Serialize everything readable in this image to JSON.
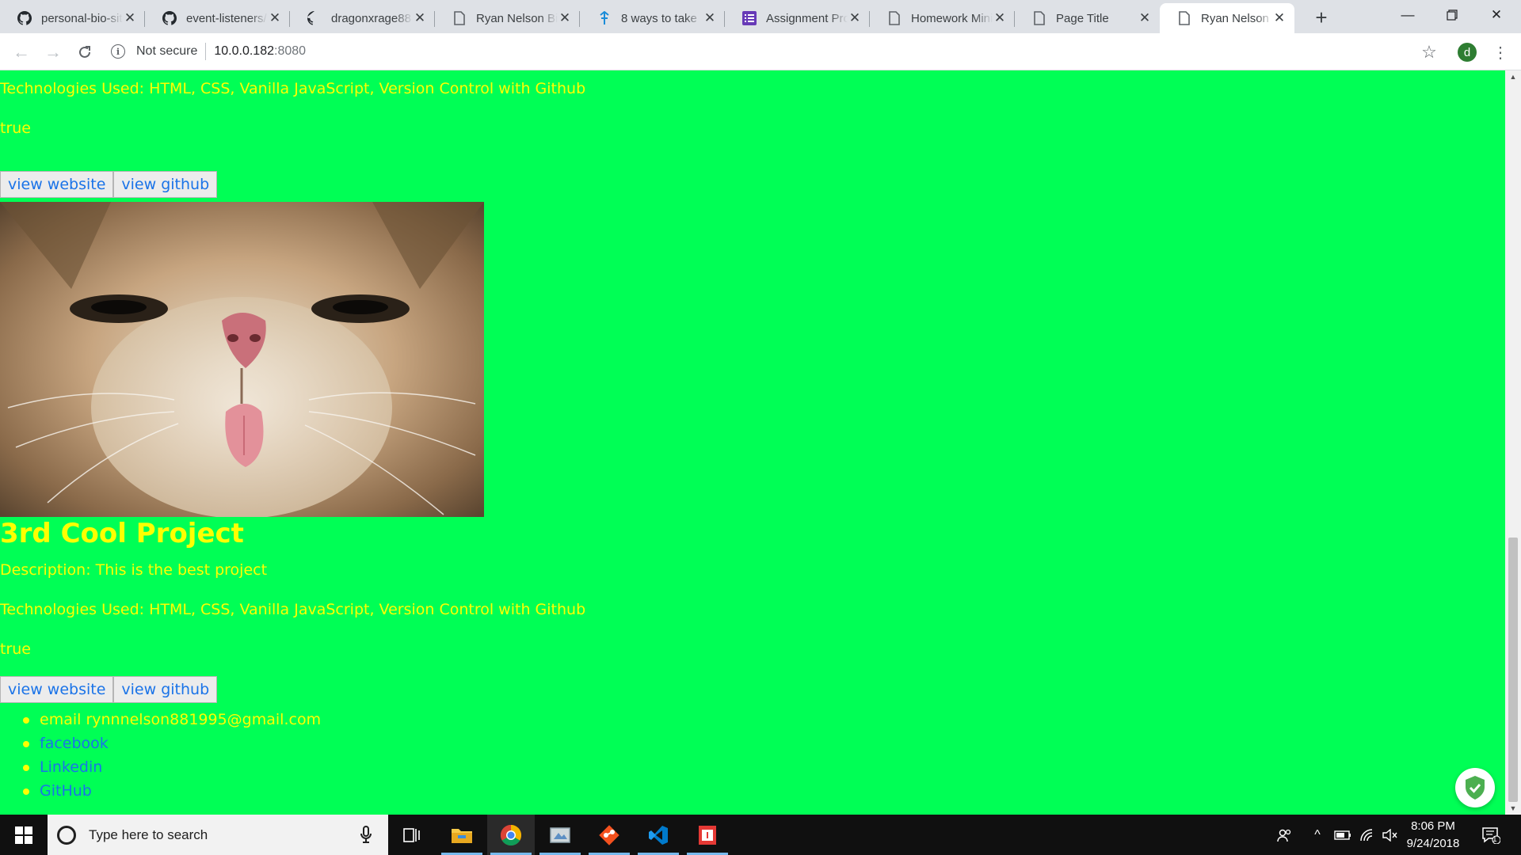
{
  "browser": {
    "tabs": [
      {
        "title": "personal-bio-site",
        "favicon": "github-icon"
      },
      {
        "title": "event-listeners/",
        "favicon": "github-icon"
      },
      {
        "title": "dragonxrage88",
        "favicon": "github-icon"
      },
      {
        "title": "Ryan Nelson Bio",
        "favicon": "page-icon"
      },
      {
        "title": "8 ways to take",
        "favicon": "pin-icon"
      },
      {
        "title": "Assignment Pro",
        "favicon": "list-icon"
      },
      {
        "title": "Homework Mini",
        "favicon": "page-icon"
      },
      {
        "title": "Page Title",
        "favicon": "page-icon"
      },
      {
        "title": "Ryan Nelson Bio",
        "favicon": "page-icon",
        "active": true
      }
    ],
    "address": {
      "security_label": "Not secure",
      "host": "10.0.0.182",
      "port": ":8080"
    },
    "profile_initial": "d"
  },
  "page": {
    "background_color": "#00ff55",
    "text_color": "#ffff00",
    "link_color": "#1a73e8",
    "project_2": {
      "technologies": "Technologies Used: HTML, CSS, Vanilla JavaScript, Version Control with Github",
      "available": "true",
      "website_button": "view website",
      "github_button": "view github"
    },
    "project_3": {
      "title": "3rd Cool Project",
      "description": "Description: This is the best project",
      "technologies": "Technologies Used: HTML, CSS, Vanilla JavaScript, Version Control with Github",
      "available": "true",
      "website_button": "view website",
      "github_button": "view github"
    },
    "contacts": {
      "email": "email rynnnelson881995@gmail.com",
      "facebook": "facebook",
      "linkedin": "Linkedin",
      "github": "GitHub"
    }
  },
  "taskbar": {
    "search_placeholder": "Type here to search",
    "time": "8:06 PM",
    "date": "9/24/2018",
    "notification_count": "1"
  }
}
